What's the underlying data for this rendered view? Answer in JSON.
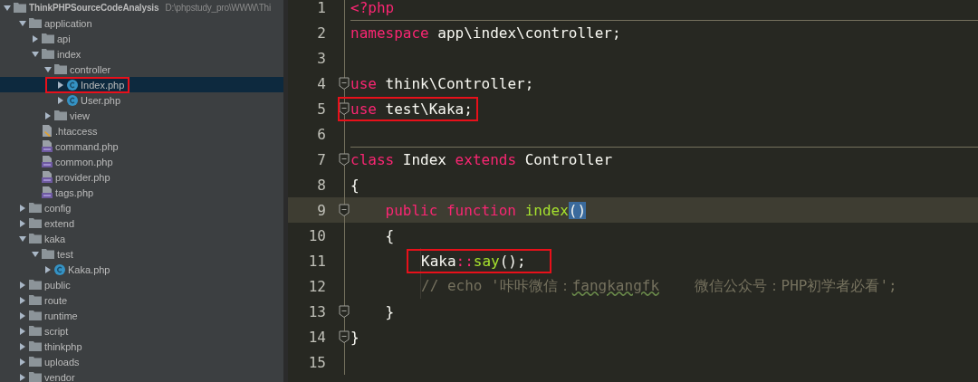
{
  "project_tree": {
    "items": [
      {
        "name": "ThinkPHPSourceCodeAnalysis",
        "path": "D:\\phpstudy_pro\\WWW\\Thi",
        "kind": "folder",
        "expanded": true,
        "selected": false,
        "children": [
          {
            "name": "application",
            "kind": "folder",
            "expanded": true,
            "selected": false,
            "children": [
              {
                "name": "api",
                "kind": "folder",
                "expanded": false,
                "selected": false
              },
              {
                "name": "index",
                "kind": "folder",
                "expanded": true,
                "selected": false,
                "children": [
                  {
                    "name": "controller",
                    "kind": "folder",
                    "expanded": true,
                    "selected": false,
                    "children": [
                      {
                        "name": "Index.php",
                        "kind": "class",
                        "expanded": false,
                        "selected": true,
                        "highlighted": true
                      },
                      {
                        "name": "User.php",
                        "kind": "class",
                        "expanded": false,
                        "selected": false
                      }
                    ]
                  },
                  {
                    "name": "view",
                    "kind": "folder",
                    "expanded": false,
                    "selected": false
                  }
                ]
              },
              {
                "name": ".htaccess",
                "kind": "config",
                "selected": false
              },
              {
                "name": "command.php",
                "kind": "php",
                "selected": false
              },
              {
                "name": "common.php",
                "kind": "php",
                "selected": false
              },
              {
                "name": "provider.php",
                "kind": "php",
                "selected": false
              },
              {
                "name": "tags.php",
                "kind": "php",
                "selected": false
              }
            ]
          },
          {
            "name": "config",
            "kind": "folder",
            "expanded": false,
            "selected": false
          },
          {
            "name": "extend",
            "kind": "folder",
            "expanded": false,
            "selected": false
          },
          {
            "name": "kaka",
            "kind": "folder",
            "expanded": true,
            "selected": false,
            "children": [
              {
                "name": "test",
                "kind": "folder",
                "expanded": true,
                "selected": false,
                "children": [
                  {
                    "name": "Kaka.php",
                    "kind": "class",
                    "expanded": false,
                    "selected": false
                  }
                ]
              }
            ]
          },
          {
            "name": "public",
            "kind": "folder",
            "expanded": false,
            "selected": false
          },
          {
            "name": "route",
            "kind": "folder",
            "expanded": false,
            "selected": false
          },
          {
            "name": "runtime",
            "kind": "folder",
            "expanded": false,
            "selected": false
          },
          {
            "name": "script",
            "kind": "folder",
            "expanded": false,
            "selected": false
          },
          {
            "name": "thinkphp",
            "kind": "folder",
            "expanded": false,
            "selected": false
          },
          {
            "name": "uploads",
            "kind": "folder",
            "expanded": false,
            "selected": false
          },
          {
            "name": "vendor",
            "kind": "folder",
            "expanded": false,
            "selected": false
          }
        ]
      }
    ]
  },
  "editor": {
    "lines": [
      {
        "number": "1",
        "tokens": [
          {
            "kind": "keyword",
            "text": "<?php"
          }
        ]
      },
      {
        "number": "2",
        "separator": true,
        "tokens": [
          {
            "kind": "keyword",
            "text": "namespace"
          },
          {
            "kind": "plain",
            "text": " app\\index\\controller;"
          }
        ]
      },
      {
        "number": "3"
      },
      {
        "number": "4",
        "fold": true,
        "tokens": [
          {
            "kind": "keyword",
            "text": "use"
          },
          {
            "kind": "plain",
            "text": " think\\Controller;"
          }
        ]
      },
      {
        "number": "5",
        "fold": true,
        "highlighted": true,
        "tokens": [
          {
            "kind": "keyword",
            "text": "use"
          },
          {
            "kind": "plain",
            "text": " test\\Kaka;"
          }
        ]
      },
      {
        "number": "6"
      },
      {
        "number": "7",
        "fold": true,
        "separator": true,
        "tokens": [
          {
            "kind": "keyword",
            "text": "class"
          },
          {
            "kind": "plain",
            "text": " Index "
          },
          {
            "kind": "keyword",
            "text": "extends"
          },
          {
            "kind": "plain",
            "text": " Controller"
          }
        ]
      },
      {
        "number": "8",
        "tokens": [
          {
            "kind": "plain",
            "text": "{"
          }
        ],
        "children": [
          {
            "number": "9",
            "fold": true,
            "current": true,
            "tokens": [
              {
                "kind": "keyword",
                "text": "public"
              },
              {
                "kind": "keyword",
                "text": " function"
              },
              {
                "kind": "function",
                "text": " index"
              },
              {
                "kind": "match",
                "text": "()"
              }
            ]
          },
          {
            "number": "10",
            "tokens": [
              {
                "kind": "plain",
                "text": "{"
              }
            ],
            "children": [
              {
                "number": "11",
                "highlighted": true,
                "tokens": [
                  {
                    "kind": "plain",
                    "text": "Kaka"
                  },
                  {
                    "kind": "keyword",
                    "text": "::"
                  },
                  {
                    "kind": "function",
                    "text": "say"
                  },
                  {
                    "kind": "plain",
                    "text": "();"
                  }
                ]
              },
              {
                "number": "12",
                "tokens": [
                  {
                    "kind": "comment",
                    "text": "// echo '咔咔微信："
                  },
                  {
                    "kind": "typo",
                    "text": "fangkangfk"
                  },
                  {
                    "kind": "comment",
                    "text": "    微信公众号：PHP初学者必看';"
                  }
                ]
              }
            ]
          },
          {
            "number": "13",
            "fold": true,
            "tokens": [
              {
                "kind": "plain",
                "text": "}"
              }
            ]
          }
        ]
      },
      {
        "number": "14",
        "fold": true,
        "tokens": [
          {
            "kind": "plain",
            "text": "}"
          }
        ]
      },
      {
        "number": "15"
      }
    ]
  }
}
